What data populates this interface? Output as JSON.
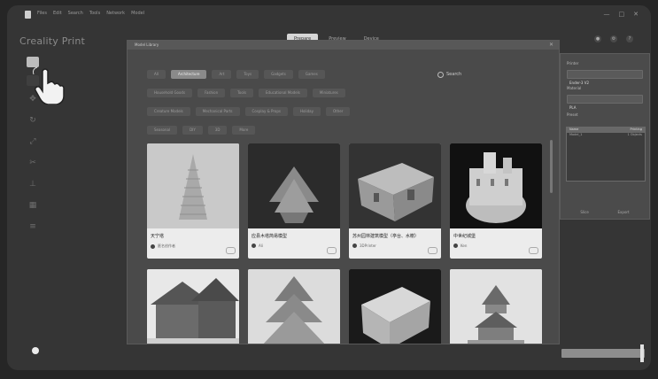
{
  "app": {
    "title": "Creality Print"
  },
  "menu": [
    "Files",
    "Edit",
    "Search",
    "Tools",
    "Network",
    "Model"
  ],
  "window_controls": [
    "—",
    "□",
    "✕"
  ],
  "tabs": [
    {
      "label": "Prepare",
      "active": true
    },
    {
      "label": "Preview",
      "active": false
    },
    {
      "label": "Device",
      "active": false
    }
  ],
  "toolbar": {
    "tools": [
      "open-file",
      "add",
      "move",
      "rotate",
      "scale",
      "cut",
      "support",
      "arrange",
      "layer"
    ]
  },
  "modal": {
    "title": "Model Library",
    "close": "✕",
    "search_placeholder": "Search",
    "category_rows": [
      [
        "All",
        "Architecture",
        "Art",
        "Toys",
        "Gadgets",
        "Games"
      ],
      [
        "Household Goods",
        "Fashion",
        "Tools",
        "Educational Models",
        "Miniatures"
      ],
      [
        "Creature Models",
        "Mechanical Parts",
        "Cosplay & Props",
        "Holiday",
        "Other"
      ],
      [
        "Seasonal",
        "DIY",
        "3D",
        "More"
      ]
    ],
    "active_category": "Architecture",
    "cards": [
      {
        "title": "天宁塔",
        "author": "匿名创作者",
        "row": 1
      },
      {
        "title": "应县木塔简易模型",
        "author": "Ali",
        "row": 1
      },
      {
        "title": "苏州园林建筑模型（亭台、水榭）",
        "author": "3DPrinter",
        "row": 1
      },
      {
        "title": "中世纪城堡",
        "author": "Ken",
        "row": 1
      },
      {
        "title": "",
        "author": "",
        "row": 2
      },
      {
        "title": "",
        "author": "",
        "row": 2
      },
      {
        "title": "",
        "author": "",
        "row": 2
      },
      {
        "title": "",
        "author": "",
        "row": 2
      }
    ]
  },
  "right_panel": {
    "lines": [
      "Printer",
      "Ender-3 V2",
      "Material",
      "PLA",
      "Preset"
    ],
    "table_header": [
      "Name",
      "Printing"
    ],
    "table_rows": [
      [
        "Model_1",
        "1 Objects"
      ]
    ],
    "buttons": [
      "Slice",
      "Export"
    ]
  },
  "colors": {
    "accent": "#d6d6d6",
    "background": "#353535",
    "modal": "#4a4a4a"
  }
}
